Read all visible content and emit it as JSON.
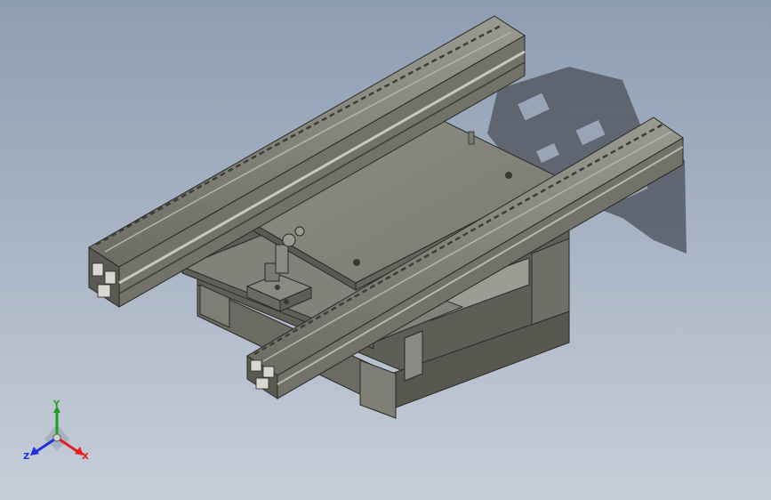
{
  "viewport": {
    "background_top": "#8e9db2",
    "background_bottom": "#c7ced8",
    "model_color": "#7a7a70",
    "shadow_color": "#4b4f58"
  },
  "triad": {
    "x_label": "X",
    "y_label": "Y",
    "z_label": "Z",
    "x_color": "#e02020",
    "y_color": "#20a020",
    "z_color": "#2030e0"
  }
}
